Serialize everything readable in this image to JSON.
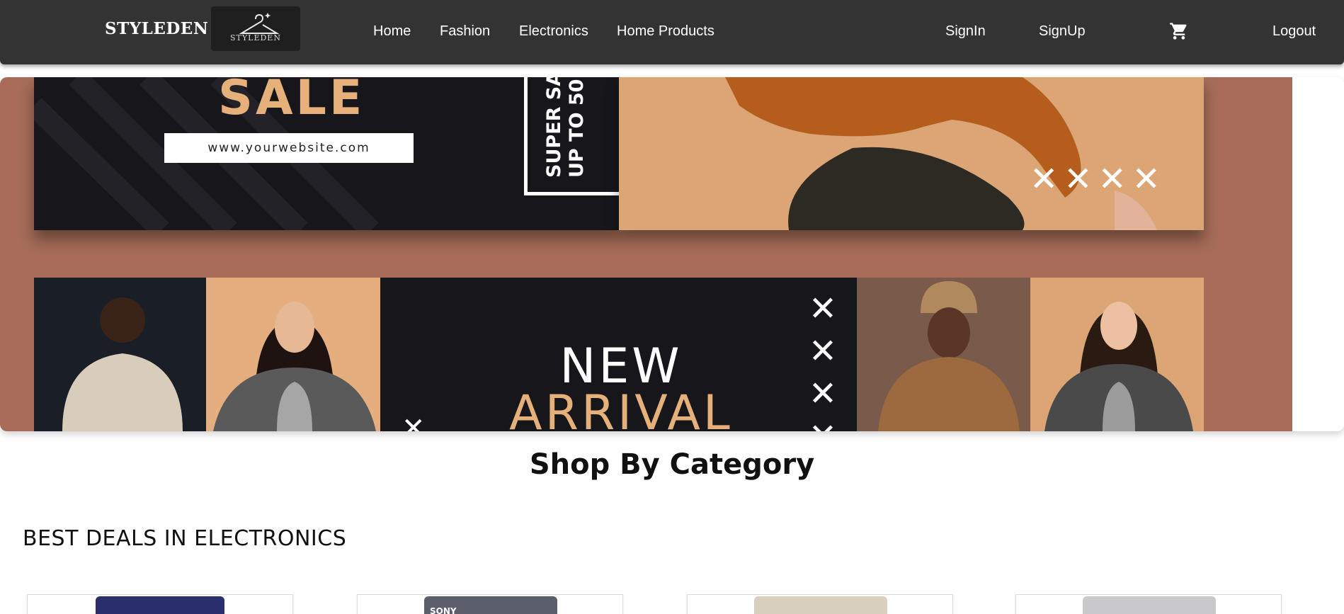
{
  "navbar": {
    "brand": "STYLEDEN",
    "logo_text": "STYLEDEN",
    "links": [
      "Home",
      "Fashion",
      "Electronics",
      "Home Products"
    ],
    "signin": "SignIn",
    "signup": "SignUp",
    "cart_icon": "cart-icon",
    "logout": "Logout"
  },
  "banner": {
    "sale": "SALE",
    "website": "www.yourwebsite.com",
    "super_sale": "SUPER SA",
    "up_to": "UP TO 50",
    "new": "NEW",
    "arrival": "ARRIVAL",
    "x_mark": "✕"
  },
  "sections": {
    "category_title": "Shop By Category",
    "deals_title": "BEST DEALS IN ELECTRONICS"
  },
  "deal_cards": [
    {
      "thumb_color": "#2b2f6e"
    },
    {
      "thumb_color": "#5a5f6b",
      "thumb_label": "SONY"
    },
    {
      "thumb_color": "#d8cfbf"
    },
    {
      "thumb_color": "#c9c9cc"
    }
  ],
  "colors": {
    "navbar_bg": "#333333",
    "banner_brown": "#a66c57",
    "panel_dark": "#17161b",
    "accent_tan": "#e6b07a"
  }
}
